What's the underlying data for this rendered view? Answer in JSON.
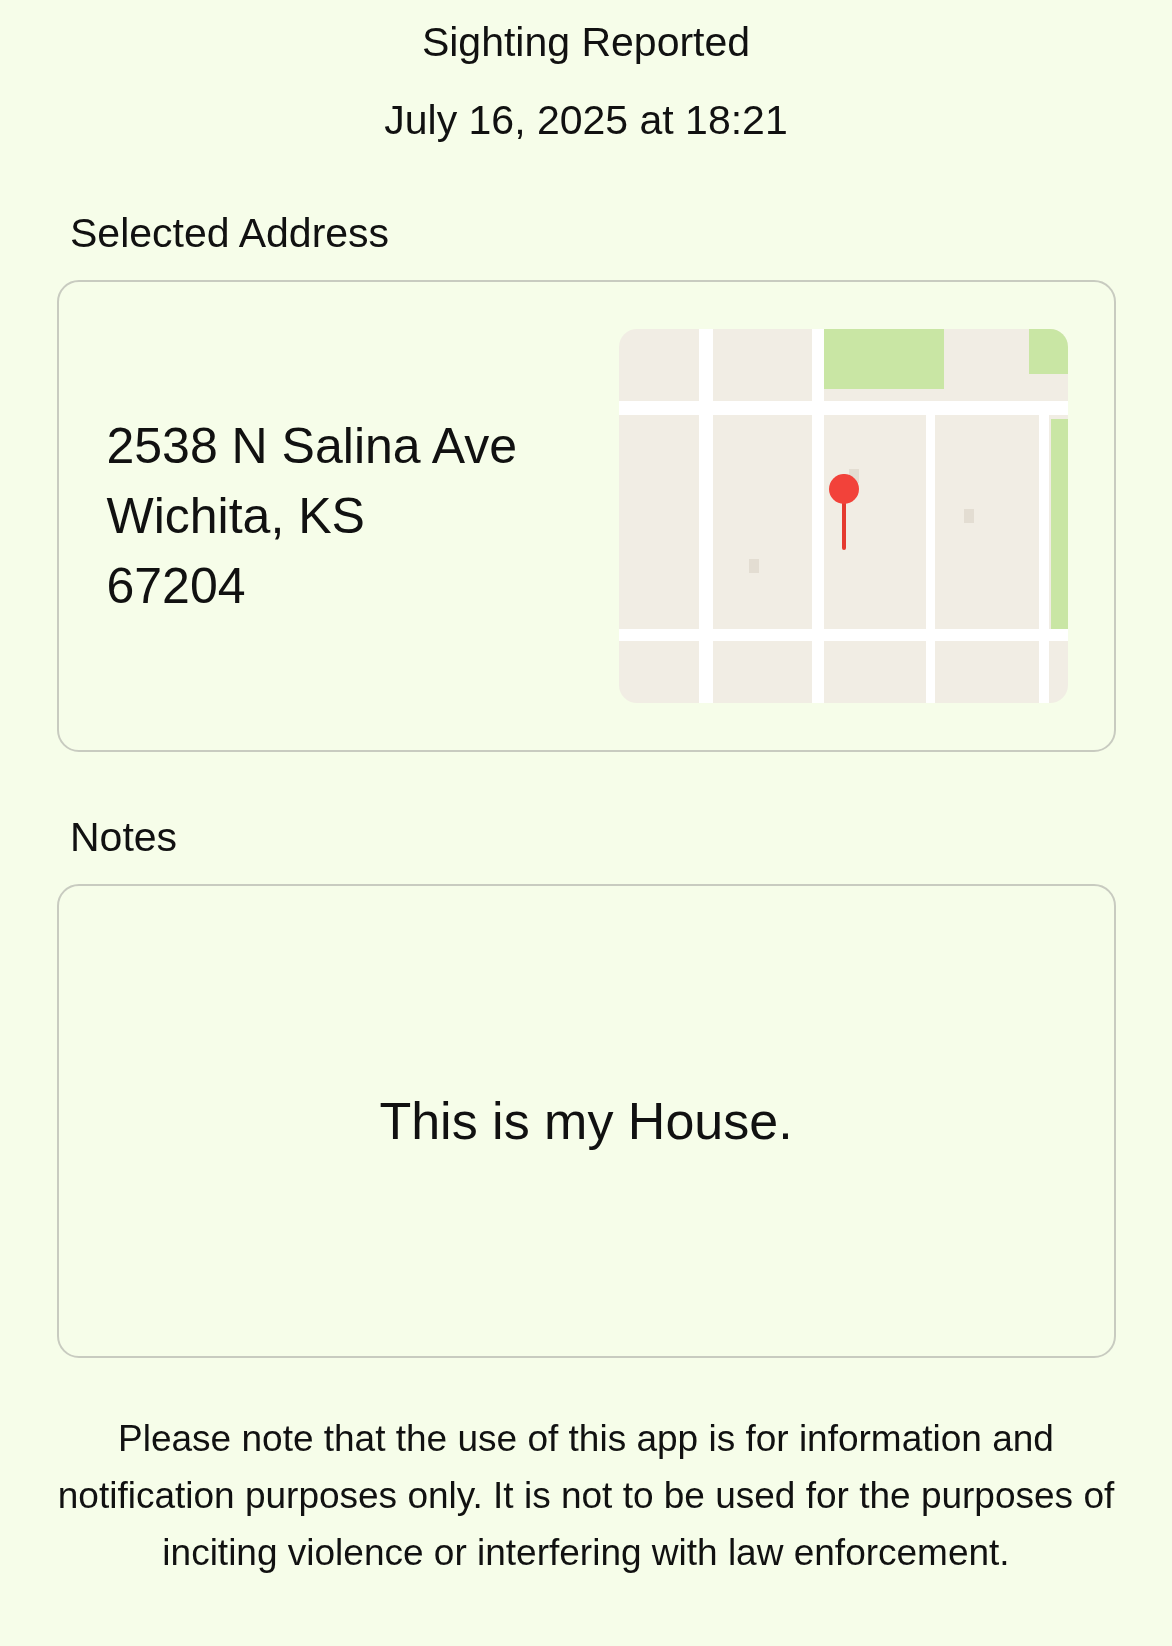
{
  "header": {
    "title": "Sighting Reported",
    "date": "July 16, 2025 at 18:21"
  },
  "address": {
    "label": "Selected Address",
    "lines": [
      "2538 N Salina Ave",
      "Wichita, KS",
      "67204"
    ]
  },
  "notes": {
    "label": "Notes",
    "text": "This is my House."
  },
  "disclaimer": "Please note that the use of this app is for information and notification purposes only. It is not to be used for the purposes of inciting violence or interfering with law enforcement."
}
